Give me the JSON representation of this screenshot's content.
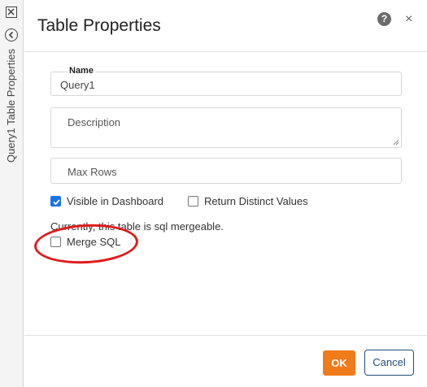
{
  "sidebar": {
    "close_icon": "close-box-icon",
    "back_icon": "circle-chevron-left-icon",
    "vertical_title": "Query1 Table Properties"
  },
  "dialog": {
    "title": "Table Properties",
    "help_glyph": "?",
    "close_glyph": "×"
  },
  "form": {
    "name": {
      "label": "Name",
      "value": "Query1"
    },
    "description": {
      "placeholder": "Description",
      "value": ""
    },
    "max_rows": {
      "placeholder": "Max Rows",
      "value": ""
    },
    "visible_in_dashboard": {
      "label": "Visible in Dashboard",
      "checked": true
    },
    "return_distinct_values": {
      "label": "Return Distinct Values",
      "checked": false
    },
    "merge_note": "Currently, this table is sql mergeable.",
    "merge_sql": {
      "label": "Merge SQL",
      "checked": false
    }
  },
  "annotation": {
    "color": "#e01b1b"
  },
  "footer": {
    "ok_label": "OK",
    "cancel_label": "Cancel"
  },
  "colors": {
    "accent": "#f07b1b",
    "checkbox_checked": "#1a73e8",
    "cancel_border": "#1f4e79"
  }
}
